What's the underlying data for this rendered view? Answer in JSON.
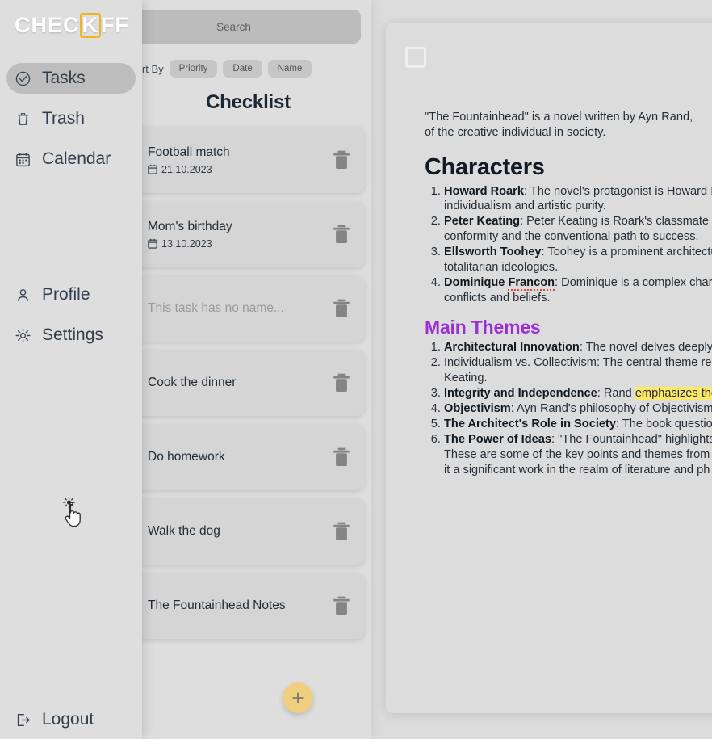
{
  "sidebar": {
    "logo": {
      "pre": "CHEC",
      "boxed": "K",
      "post": "FF"
    },
    "items": [
      {
        "label": "Tasks",
        "icon": "check-circle-icon",
        "active": true
      },
      {
        "label": "Trash",
        "icon": "trash-icon",
        "active": false
      },
      {
        "label": "Calendar",
        "icon": "calendar-icon",
        "active": false
      },
      {
        "label": "Profile",
        "icon": "user-icon",
        "active": false
      },
      {
        "label": "Settings",
        "icon": "gear-icon",
        "active": false
      }
    ],
    "logout": {
      "label": "Logout",
      "icon": "logout-icon"
    }
  },
  "checklist": {
    "search": {
      "placeholder": "Search",
      "value": ""
    },
    "sort": {
      "label": "Sort By",
      "options": [
        "Priority",
        "Date",
        "Name"
      ]
    },
    "title": "Checklist",
    "add_button_label": "+",
    "tasks": [
      {
        "name": "Football match",
        "date": "21.10.2023",
        "empty": false
      },
      {
        "name": "Mom's birthday",
        "date": "13.10.2023",
        "empty": false
      },
      {
        "name": "This task has no name...",
        "date": "",
        "empty": true
      },
      {
        "name": "Cook the dinner",
        "date": "",
        "empty": false
      },
      {
        "name": "Do homework",
        "date": "",
        "empty": false
      },
      {
        "name": "Walk the dog",
        "date": "",
        "empty": false
      },
      {
        "name": "The Fountainhead Notes",
        "date": "",
        "empty": false
      }
    ]
  },
  "document": {
    "intro_line_1": "\"The Fountainhead\" is a novel written by Ayn Rand,",
    "intro_line_2": "of the creative individual in society.",
    "heading_characters": "Characters",
    "heading_main_themes": "Main Themes",
    "characters": [
      {
        "term": "Howard Roark",
        "rest": ": The novel's protagonist is Howard I",
        "cont": "individualism and artistic purity."
      },
      {
        "term": "Peter Keating",
        "rest": ": Peter Keating is Roark's classmate a",
        "cont": "conformity and the conventional path to success."
      },
      {
        "term": "Ellsworth Toohey",
        "rest": ": Toohey is a prominent architectu",
        "cont": "totalitarian ideologies."
      },
      {
        "term": "Dominique Francon",
        "rest": ": Dominique is a complex chara",
        "cont": "conflicts and beliefs."
      }
    ],
    "themes": [
      {
        "term": "Architectural Innovation",
        "rest": ": The novel delves deeply i",
        "cont": ""
      },
      {
        "term": "",
        "rest": "Individualism vs. Collectivism: The central theme re",
        "cont": "Keating."
      },
      {
        "term": "Integrity and Independence",
        "rest_a": ": Rand ",
        "highlight": "emphasizes the ",
        "cont": ""
      },
      {
        "term": "Objectivism",
        "rest": ": Ayn Rand's philosophy of Objectivism",
        "cont": ""
      },
      {
        "term": "The Architect's Role in Society",
        "rest": ": The book question",
        "cont": ""
      },
      {
        "term": "The Power of Ideas",
        "rest": ": \"The Fountainhead\" highlights",
        "cont": ""
      }
    ],
    "tail_line_1": "These are some of the key points and themes from A",
    "tail_line_2": "it a significant work in the realm of literature and ph",
    "grip_icon": "drag-handle-icon",
    "trash_icon": "trash-icon",
    "checkbox_checked": false
  },
  "colors": {
    "accent_yellow": "#efce7f",
    "logo_box": "#f0b323",
    "heading_purple": "#9a2fd6",
    "highlight_yellow": "#ffe866",
    "panel_bg": "#dcdcdc",
    "card_bg": "#d5d5d5",
    "search_bg": "#bcbcbc"
  }
}
